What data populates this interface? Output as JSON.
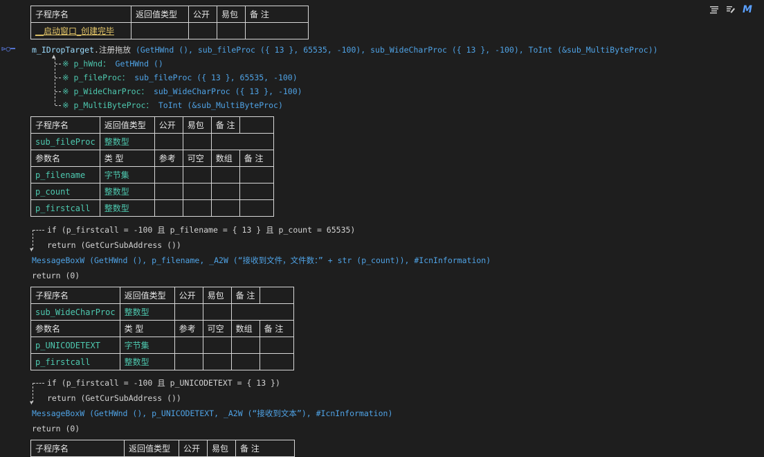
{
  "toolbar": {
    "icons": [
      "format-icon",
      "edit-icon",
      "logo-icon"
    ],
    "logo_text": "M"
  },
  "headers": {
    "sub_name": "子程序名",
    "ret_type": "返回值类型",
    "public": "公开",
    "easy_pack": "易包",
    "remark": "备 注",
    "param_name": "参数名",
    "type": "类 型",
    "ref": "参考",
    "nullable": "可空",
    "array": "数组"
  },
  "sub1": {
    "name": "__启动窗口_创建完毕"
  },
  "call": {
    "obj": "m_IDropTarget",
    "method": ".注册拖放",
    "args_text": " (GetHWnd (), sub_fileProc ({ 13 }, 65535, -100), sub_WideCharProc ({ 13 }, -100), ToInt (&sub_MultiByteProc))",
    "p1_label": "※ p_hWnd：",
    "p1_value": "GetHWnd ()",
    "p2_label": "※ p_fileProc：",
    "p2_value": "sub_fileProc ({ 13 }, 65535, -100)",
    "p3_label": "※ p_WideCharProc：",
    "p3_value": "sub_WideCharProc ({ 13 }, -100)",
    "p4_label": "※ p_MultiByteProc：",
    "p4_value": "ToInt (&sub_MultiByteProc)"
  },
  "sub2": {
    "name": "sub_fileProc",
    "ret": "整数型",
    "params": [
      {
        "name": "p_filename",
        "type": "字节集"
      },
      {
        "name": "p_count",
        "type": "整数型"
      },
      {
        "name": "p_firstcall",
        "type": "整数型"
      }
    ],
    "code": {
      "if_line": "if (p_firstcall = -100 且 p_filename = { 13 } 且 p_count = 65535)",
      "return1": "return (GetCurSubAddress ())",
      "msgbox": "MessageBoxW (GetHWnd (), p_filename, _A2W (“接收到文件，文件数：” + str (p_count)), #IcnInformation)",
      "return2": "return (0)"
    }
  },
  "sub3": {
    "name": "sub_WideCharProc",
    "ret": "整数型",
    "params": [
      {
        "name": "p_UNICODETEXT",
        "type": "字节集"
      },
      {
        "name": "p_firstcall",
        "type": "整数型"
      }
    ],
    "code": {
      "if_line": "if (p_firstcall = -100 且 p_UNICODETEXT = { 13 })",
      "return1": "return (GetCurSubAddress ())",
      "msgbox": "MessageBoxW (GetHWnd (), p_UNICODETEXT, _A2W (“接收到文本”), #IcnInformation)",
      "return2": "return (0)"
    }
  }
}
